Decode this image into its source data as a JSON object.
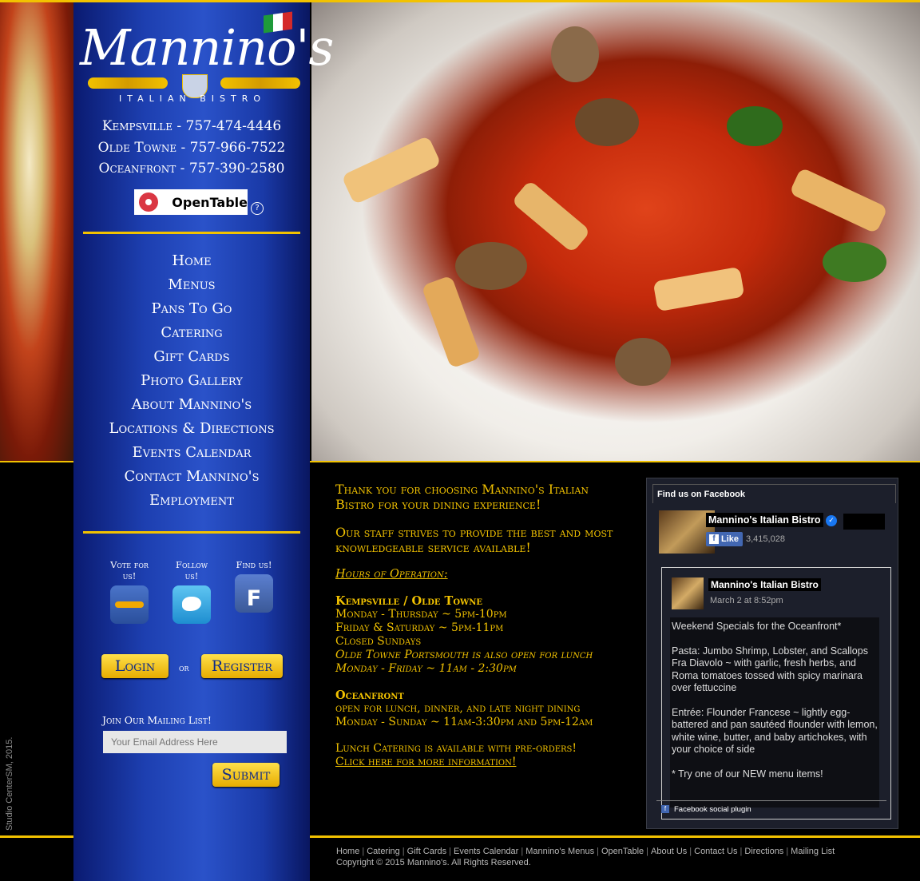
{
  "brand": {
    "logo_script": "Mannino's",
    "logo_sub": "ITALIAN BISTRO"
  },
  "locations": [
    "Kempsville - 757-474-4446",
    "Olde Towne - 757-966-7522",
    "Oceanfront - 757-390-2580"
  ],
  "opentable_label": "OpenTable",
  "opentable_help": "?",
  "nav": [
    "Home",
    "Menus",
    "Pans To Go",
    "Catering",
    "Gift Cards",
    "Photo Gallery",
    "About Mannino's",
    "Locations & Directions",
    "Events Calendar",
    "Contact Mannino's",
    "Employment"
  ],
  "social": {
    "vote": "Vote for us!",
    "follow": "Follow us!",
    "find": "Find us!"
  },
  "auth": {
    "login": "Login",
    "or": "or",
    "register": "Register"
  },
  "mailing": {
    "label": "Join Our Mailing List!",
    "placeholder": "Your Email Address Here",
    "submit": "Submit"
  },
  "content": {
    "thanks": "Thank you for choosing Mannino's Italian Bistro for your dining experience!",
    "staff": "Our staff strives to provide the best and most knowledgeable service available!",
    "hours_heading": "Hours of Operation:",
    "kemps_heading": "Kempsville / Olde Towne",
    "kemps_1": "Monday - Thursday ~ 5pm-10pm",
    "kemps_2": "Friday & Saturday  ~ 5pm-11pm",
    "kemps_3": "Closed Sundays",
    "kemps_4": "Olde Towne Portsmouth is also open for lunch Monday - Friday ~ 11am - 2:30pm",
    "ocean_heading": "Oceanfront",
    "ocean_1": "open for lunch, dinner, and late night dining",
    "ocean_2": "Monday - Sunday ~ 11am-3:30pm and 5pm-12am",
    "catering_1": "Lunch Catering is available with pre-orders!",
    "catering_link": "Click here for more information!"
  },
  "facebook": {
    "heading": "Find us on Facebook",
    "page_name": "Mannino's Italian Bistro",
    "like": "Like",
    "like_count": "3,415,028",
    "post_name": "Mannino's Italian Bistro",
    "post_date": "March 2 at 8:52pm",
    "post_lines": [
      "Weekend Specials for the Oceanfront*",
      "Pasta: Jumbo Shrimp, Lobster, and Scallops Fra Diavolo ~ with garlic, fresh herbs, and Roma tomatoes tossed with spicy marinara over fettuccine",
      "Entrée: Flounder Francese ~ lightly egg-battered and pan sautéed flounder with lemon, white wine, butter, and baby artichokes, with your choice of side",
      "* Try one of our NEW menu items!"
    ],
    "plugin_label": "Facebook social plugin"
  },
  "credit": "Studio CenterSM, 2015.",
  "footer": {
    "links": [
      "Home",
      "Catering",
      "Gift Cards",
      "Events Calendar",
      "Mannino's Menus",
      "OpenTable",
      "About Us",
      "Contact Us",
      "Directions",
      "Mailing List"
    ],
    "copyright": "Copyright © 2015 Mannino's. All Rights Reserved."
  },
  "colors": {
    "gold": "#f2c200",
    "sidebar_blue": "#1d3fb0",
    "background": "#000000"
  },
  "icons": {
    "urbanspoon": "urbanspoon-icon",
    "twitter": "twitter-icon",
    "facebook": "facebook-icon"
  }
}
